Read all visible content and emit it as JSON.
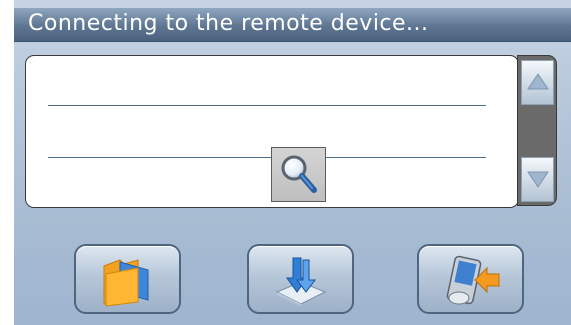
{
  "dialog": {
    "title": "Connecting to the remote device..."
  },
  "device_list": {
    "rows": 2,
    "status_icon": "magnifier-icon"
  },
  "scrollbar": {
    "up_icon": "arrow-up-icon",
    "down_icon": "arrow-down-icon"
  },
  "toolbar": {
    "buttons": [
      {
        "name": "folder-button",
        "icon": "folder-icon"
      },
      {
        "name": "download-button",
        "icon": "download-icon"
      },
      {
        "name": "device-connect-button",
        "icon": "pda-device-icon"
      }
    ]
  },
  "colors": {
    "title_bar": "#5e7692",
    "background": "#b2c4d8",
    "panel": "#ffffff",
    "scrollbar": "#6a6a6a",
    "accent_blue": "#2f7fd6",
    "accent_orange": "#f39a1f"
  }
}
